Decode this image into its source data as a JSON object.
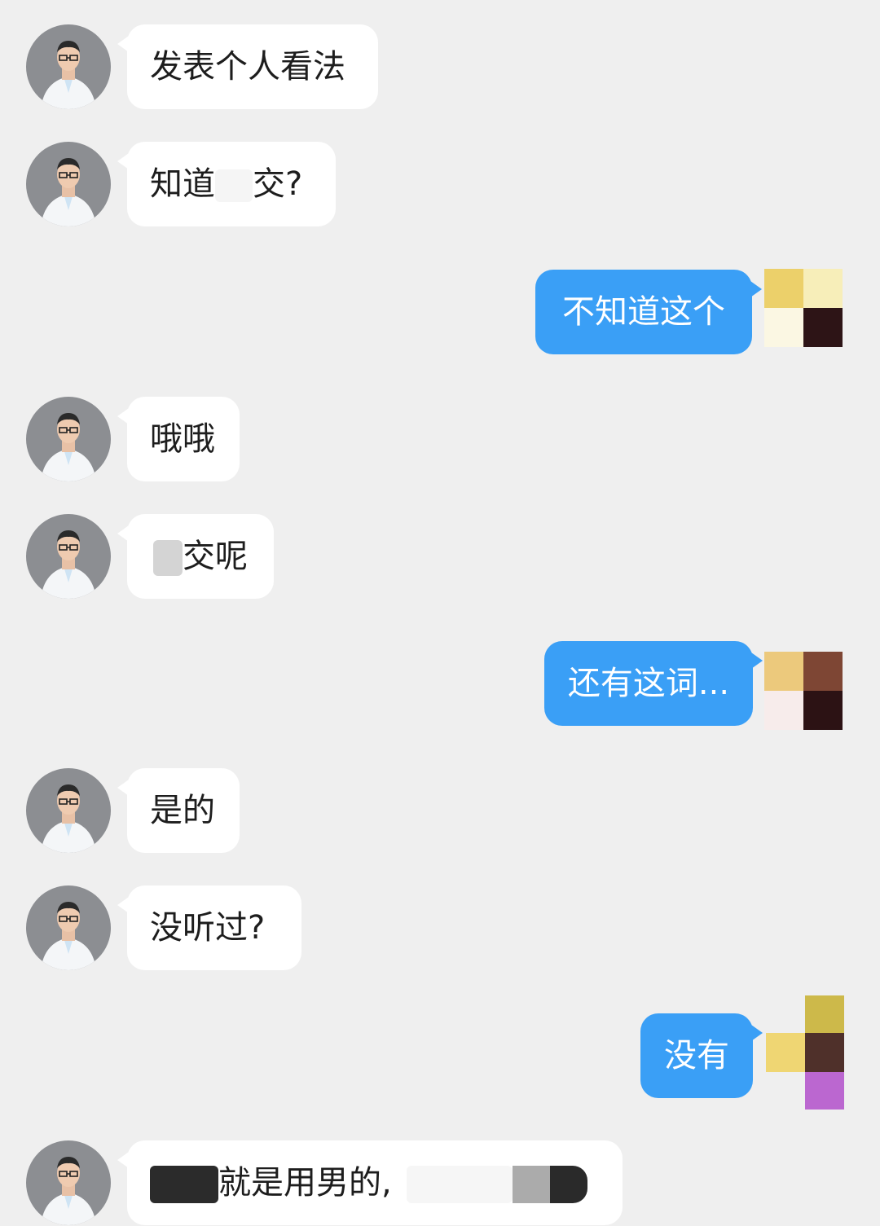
{
  "messages": [
    {
      "side": "left",
      "text": "发表个人看法"
    },
    {
      "side": "left",
      "text_a": "知道",
      "text_b": "交?"
    },
    {
      "side": "right",
      "text": "不知道这个"
    },
    {
      "side": "left",
      "text": "哦哦"
    },
    {
      "side": "left",
      "text": "交呢"
    },
    {
      "side": "right",
      "text": "还有这词..."
    },
    {
      "side": "left",
      "text": "是的"
    },
    {
      "side": "left",
      "text": "没听过?"
    },
    {
      "side": "right",
      "text": "没有"
    },
    {
      "side": "left",
      "text": "就是用男的,"
    }
  ],
  "colors": {
    "background": "#efefef",
    "left_bubble": "#ffffff",
    "right_bubble": "#3a9ff6"
  },
  "icons": {
    "contact_avatar": "doctor-avatar-icon",
    "user_avatar": "pixelated-avatar-icon"
  }
}
